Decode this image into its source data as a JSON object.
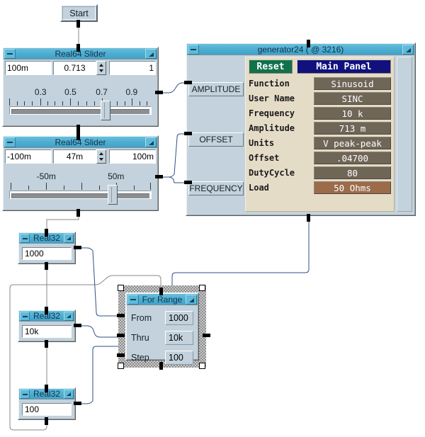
{
  "app": {
    "start_button": {
      "label": "Start"
    }
  },
  "sliders": [
    {
      "title": "Real64 Slider",
      "min": "100m",
      "value": "0.713",
      "max": "1",
      "tick_labels": [
        "0.3",
        "0.5",
        "0.7",
        "0.9"
      ],
      "thumb_percent": 68
    },
    {
      "title": "Real64 Slider",
      "min": "-100m",
      "value": "47m",
      "max": "100m",
      "tick_labels": [
        "-50m",
        "50m"
      ],
      "thumb_percent": 73
    }
  ],
  "generator": {
    "title": "generator24 ( @ 3216)",
    "terminals": [
      "AMPLITUDE",
      "OFFSET",
      "FREQUENCY"
    ],
    "reset_label": "Reset",
    "main_panel_label": "Main Panel",
    "rows": [
      {
        "key": "Function",
        "value": "Sinusoid",
        "accent": false
      },
      {
        "key": "User Name",
        "value": "SINC",
        "accent": false
      },
      {
        "key": "Frequency",
        "value": "10 k",
        "accent": false
      },
      {
        "key": "Amplitude",
        "value": "713 m",
        "accent": false
      },
      {
        "key": "Units",
        "value": "V peak-peak",
        "accent": false
      },
      {
        "key": "Offset",
        "value": ".04700",
        "accent": false
      },
      {
        "key": "DutyCycle",
        "value": "80",
        "accent": false
      },
      {
        "key": "Load",
        "value": "50 Ohms",
        "accent": true
      }
    ]
  },
  "real32": [
    {
      "title": "Real32",
      "value": "1000"
    },
    {
      "title": "Real32",
      "value": "10k"
    },
    {
      "title": "Real32",
      "value": "100"
    }
  ],
  "for_range": {
    "title": "For Range",
    "fields": [
      {
        "label": "From",
        "value": "1000"
      },
      {
        "label": "Thru",
        "value": "10k"
      },
      {
        "label": "Step",
        "value": "100"
      }
    ]
  },
  "colors": {
    "titlebar": "#4faed0",
    "panel": "#c3d2dc",
    "wire_data": "#2f4f86",
    "wire_flow": "#8a8a8a",
    "reset_green": "#11714b",
    "main_panel_blue": "#11117e",
    "gen_value_bg": "#6f6658",
    "gen_value_accent_bg": "#9c6b4a",
    "gen_main_bg": "#e5dcc8"
  }
}
